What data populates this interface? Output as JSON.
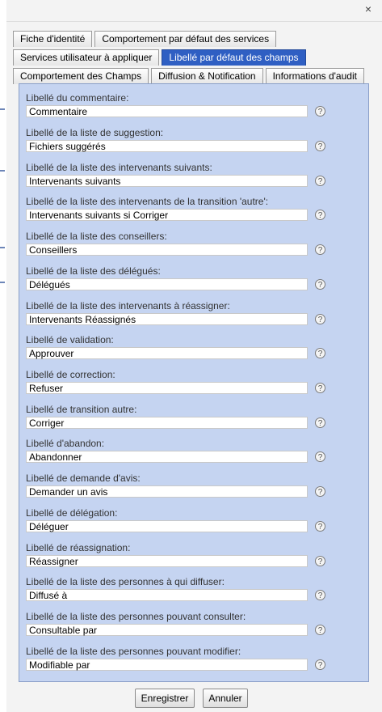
{
  "dialog": {
    "close_glyph": "×"
  },
  "tabs": {
    "row1": [
      "Fiche d'identité",
      "Comportement par défaut des services"
    ],
    "row2": [
      "Services utilisateur à appliquer",
      "Libellé par défaut des champs"
    ],
    "row3": [
      "Comportement des Champs",
      "Diffusion & Notification",
      "Informations d'audit"
    ],
    "active": "Libellé par défaut des champs"
  },
  "fields": [
    {
      "label": "Libellé du commentaire:",
      "value": "Commentaire"
    },
    {
      "label": "Libellé de la liste de suggestion:",
      "value": "Fichiers suggérés"
    },
    {
      "label": "Libellé de la liste des intervenants suivants:",
      "value": "Intervenants suivants"
    },
    {
      "label": "Libellé de la liste des intervenants de la transition 'autre':",
      "value": "Intervenants suivants si Corriger"
    },
    {
      "label": "Libellé de la liste des conseillers:",
      "value": "Conseillers"
    },
    {
      "label": "Libellé de la liste des délégués:",
      "value": "Délégués"
    },
    {
      "label": "Libellé de la liste des intervenants à réassigner:",
      "value": "Intervenants Réassignés"
    },
    {
      "label": "Libellé de validation:",
      "value": "Approuver"
    },
    {
      "label": "Libellé de correction:",
      "value": "Refuser"
    },
    {
      "label": "Libellé de transition autre:",
      "value": "Corriger"
    },
    {
      "label": "Libellé d'abandon:",
      "value": "Abandonner"
    },
    {
      "label": "Libellé de demande d'avis:",
      "value": "Demander un avis"
    },
    {
      "label": "Libellé de délégation:",
      "value": "Déléguer"
    },
    {
      "label": "Libellé de réassignation:",
      "value": "Réassigner"
    },
    {
      "label": "Libellé de la liste des personnes à qui diffuser:",
      "value": "Diffusé à"
    },
    {
      "label": "Libellé de la liste des personnes pouvant consulter:",
      "value": "Consultable par"
    },
    {
      "label": "Libellé de la liste des personnes pouvant modifier:",
      "value": "Modifiable par"
    }
  ],
  "help_glyph": "?",
  "footer": {
    "save_label": "Enregistrer",
    "cancel_label": "Annuler"
  },
  "colors": {
    "active_tab": "#2f5fc3",
    "panel_bg": "#c5d4f1"
  }
}
